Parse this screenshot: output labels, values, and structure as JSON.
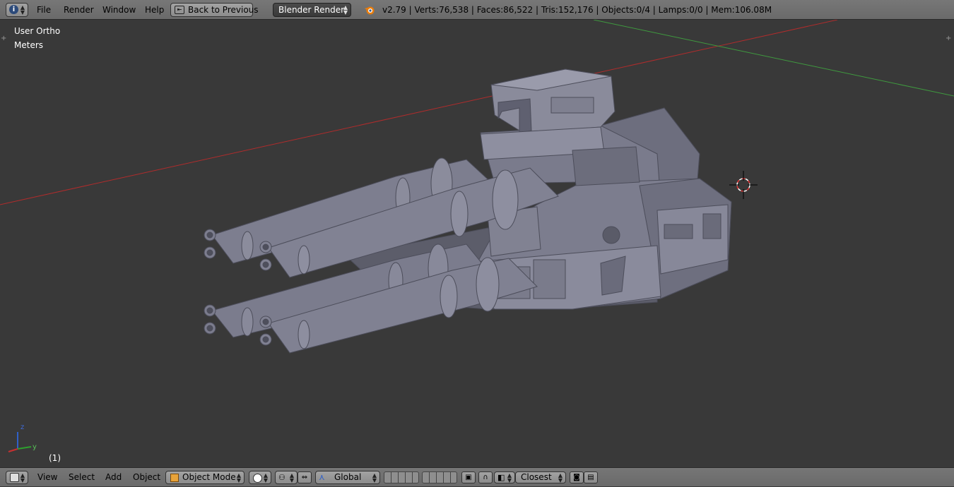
{
  "header": {
    "menu": [
      "File",
      "Render",
      "Window",
      "Help"
    ],
    "back_button": "Back to Previous",
    "engine": "Blender Render",
    "stats": "v2.79 | Verts:76,538 | Faces:86,522 | Tris:152,176 | Objects:0/4 | Lamps:0/0 | Mem:106.08M"
  },
  "viewport": {
    "view_name": "User Ortho",
    "units": "Meters",
    "frame": "(1)",
    "axis_labels": {
      "z": "z",
      "y": "y"
    }
  },
  "footer": {
    "menu": [
      "View",
      "Select",
      "Add",
      "Object"
    ],
    "mode": "Object Mode",
    "orientation": "Global",
    "snap_target": "Closest"
  },
  "colors": {
    "x_axis": "#b02c2c",
    "y_axis": "#3f9a3f",
    "model": "#6e6f80"
  }
}
